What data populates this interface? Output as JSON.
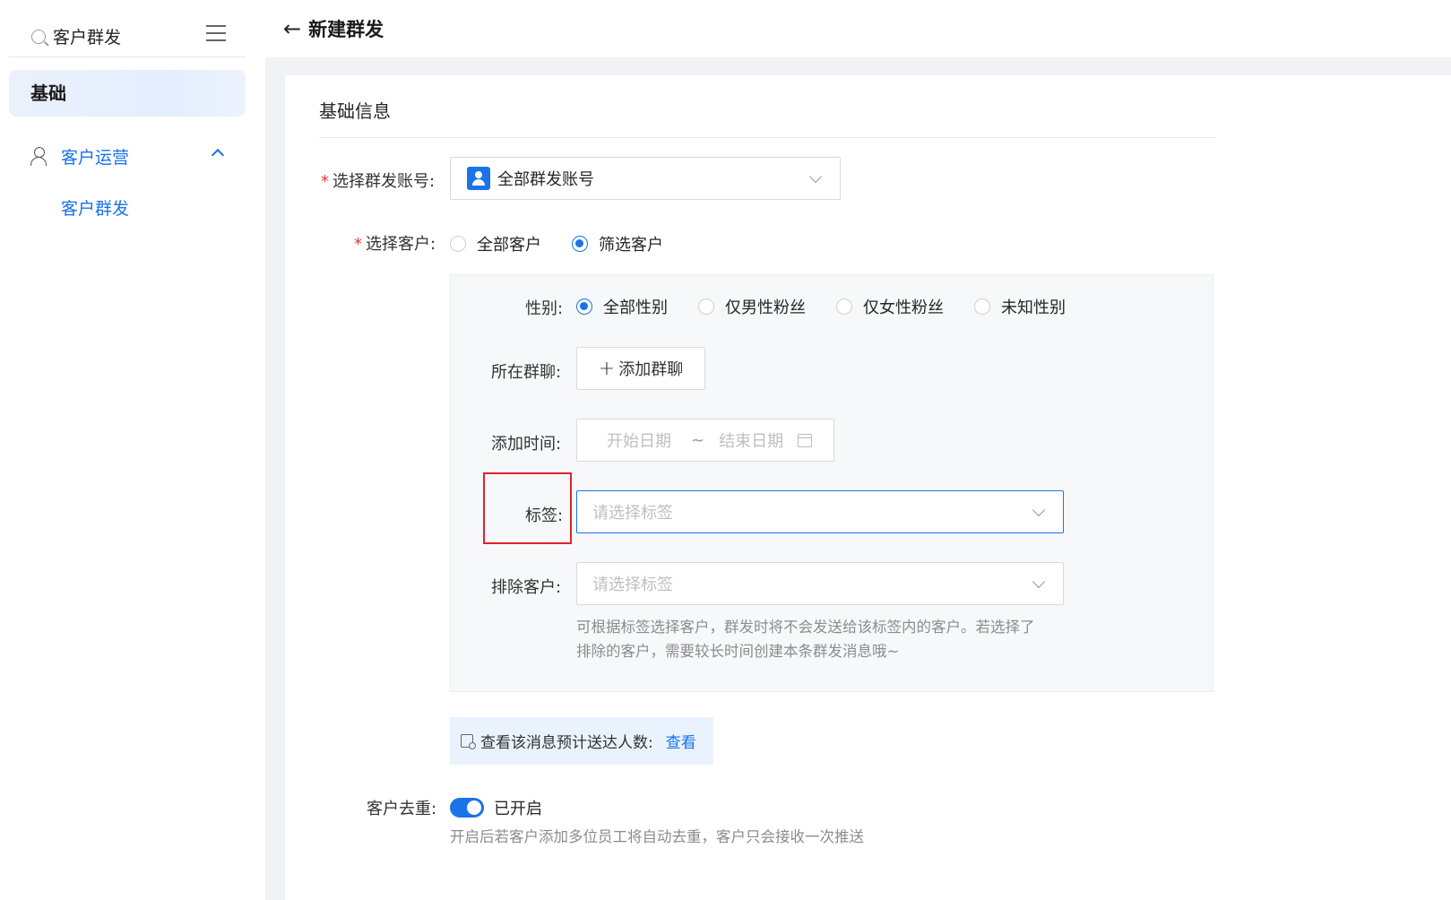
{
  "sidebar": {
    "search_value": "客户群发",
    "basic_label": "基础",
    "group_label": "客户运营",
    "sub_item": "客户群发"
  },
  "header": {
    "back_glyph": "←",
    "title": "新建群发"
  },
  "section": {
    "title": "基础信息"
  },
  "form": {
    "account": {
      "label": "选择群发账号:",
      "value": "全部群发账号"
    },
    "customers": {
      "label": "选择客户:",
      "options": [
        "全部客户",
        "筛选客户"
      ],
      "selected": "筛选客户"
    },
    "filter": {
      "gender": {
        "label": "性别:",
        "options": [
          "全部性别",
          "仅男性粉丝",
          "仅女性粉丝",
          "未知性别"
        ],
        "selected": "全部性别"
      },
      "group_chat": {
        "label": "所在群聊:",
        "button": "添加群聊"
      },
      "add_time": {
        "label": "添加时间:",
        "start_placeholder": "开始日期",
        "separator": "~",
        "end_placeholder": "结束日期"
      },
      "tags": {
        "label": "标签:",
        "placeholder": "请选择标签"
      },
      "exclude": {
        "label": "排除客户:",
        "placeholder": "请选择标签",
        "hint_line1": "可根据标签选择客户，群发时将不会发送给该标签内的客户。若选择了",
        "hint_line2": "排除的客户，需要较长时间创建本条群发消息哦~"
      }
    },
    "estimate": {
      "text": "查看该消息预计送达人数:",
      "link": "查看"
    },
    "dedupe": {
      "label": "客户去重:",
      "state": "已开启",
      "hint": "开启后若客户添加多位员工将自动去重，客户只会接收一次推送"
    }
  },
  "colors": {
    "accent": "#1a73e8",
    "highlight": "#e0222a",
    "required": "#e53935"
  }
}
